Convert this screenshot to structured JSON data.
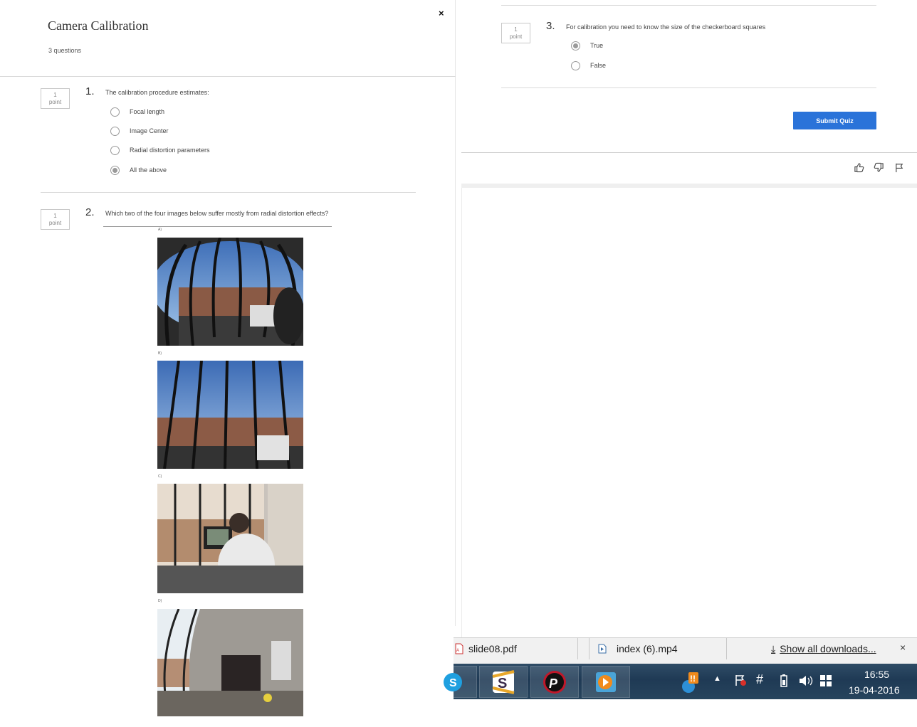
{
  "quiz": {
    "title": "Camera Calibration",
    "question_count": "3 questions",
    "close_label": "×",
    "submit_label": "Submit Quiz"
  },
  "questions": [
    {
      "number": "1.",
      "points_value": "1",
      "points_unit": "point",
      "text": "The calibration procedure estimates:",
      "options": [
        "Focal length",
        "Image Center",
        "Radial distortion parameters",
        "All the above"
      ],
      "selected_index": 3
    },
    {
      "number": "2.",
      "points_value": "1",
      "points_unit": "point",
      "text": "Which two of the four images below suffer mostly from radial distortion effects?",
      "image_labels": [
        "A)",
        "B)",
        "C)",
        "D)"
      ]
    },
    {
      "number": "3.",
      "points_value": "1",
      "points_unit": "point",
      "text": "For calibration you need to know the size of the checkerboard squares",
      "options": [
        "True",
        "False"
      ],
      "selected_index": 0
    }
  ],
  "feedback_icons": [
    "thumbs-up-icon",
    "thumbs-down-icon",
    "flag-icon"
  ],
  "downloads": {
    "items": [
      {
        "name": "slide08.pdf",
        "icon": "pdf-file-icon"
      },
      {
        "name": "index (6).mp4",
        "icon": "video-file-icon"
      }
    ],
    "show_all": "Show all downloads...",
    "close_label": "×"
  },
  "taskbar": {
    "apps": [
      "skype-icon",
      "slack-icon",
      "picsart-icon",
      "media-player-icon"
    ],
    "time": "16:55",
    "date": "19-04-2016"
  },
  "colors": {
    "submit": "#2a73d9",
    "taskbar": "#27445d"
  }
}
